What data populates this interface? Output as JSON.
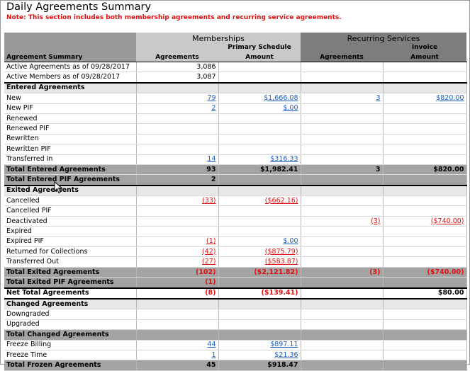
{
  "page": {
    "title": "Daily Agreements Summary",
    "note": "Note: This section includes both membership agreements and recurring service agreements."
  },
  "header": {
    "memberships": "Memberships",
    "recurring": "Recurring Services",
    "primary_schedule": "Primary Schedule",
    "invoice": "Invoice",
    "agreement_summary": "Agreement Summary",
    "agreements": "Agreements",
    "amount": "Amount",
    "agreements2": "Agreements",
    "amount2": "Amount"
  },
  "rows": [
    {
      "type": "data",
      "label": "Active Agreements as of 09/28/2017",
      "m_agr": "3,086",
      "m_amt": "",
      "r_agr": "",
      "r_amt": ""
    },
    {
      "type": "data",
      "label": "Active Members as of 09/28/2017",
      "m_agr": "3,087",
      "m_amt": "",
      "r_agr": "",
      "r_amt": ""
    },
    {
      "type": "section",
      "label": "Entered Agreements"
    },
    {
      "type": "data",
      "label": "New",
      "m_agr": "79",
      "m_amt": "$1,666.08",
      "r_agr": "3",
      "r_amt": "$820.00",
      "style": "link"
    },
    {
      "type": "data",
      "label": "New PIF",
      "m_agr": "2",
      "m_amt": "$.00",
      "r_agr": "",
      "r_amt": "",
      "style": "link"
    },
    {
      "type": "data",
      "label": "Renewed",
      "m_agr": "",
      "m_amt": "",
      "r_agr": "",
      "r_amt": ""
    },
    {
      "type": "data",
      "label": "Renewed PIF",
      "m_agr": "",
      "m_amt": "",
      "r_agr": "",
      "r_amt": ""
    },
    {
      "type": "data",
      "label": "Rewritten",
      "m_agr": "",
      "m_amt": "",
      "r_agr": "",
      "r_amt": ""
    },
    {
      "type": "data",
      "label": "Rewritten PIF",
      "m_agr": "",
      "m_amt": "",
      "r_agr": "",
      "r_amt": ""
    },
    {
      "type": "data",
      "label": "Transferred In",
      "m_agr": "14",
      "m_amt": "$316.33",
      "r_agr": "",
      "r_amt": "",
      "style": "link"
    },
    {
      "type": "total",
      "label": "Total Entered Agreements",
      "m_agr": "93",
      "m_amt": "$1,982.41",
      "r_agr": "3",
      "r_amt": "$820.00"
    },
    {
      "type": "total",
      "label": "Total Entered PIF Agreements",
      "m_agr": "2",
      "m_amt": "",
      "r_agr": "",
      "r_amt": ""
    },
    {
      "type": "section",
      "label": "Exited Agreements"
    },
    {
      "type": "data",
      "label": "Cancelled",
      "m_agr": "(33)",
      "m_amt": "($662.16)",
      "r_agr": "",
      "r_amt": "",
      "style": "neglink"
    },
    {
      "type": "data",
      "label": "Cancelled PIF",
      "m_agr": "",
      "m_amt": "",
      "r_agr": "",
      "r_amt": ""
    },
    {
      "type": "data",
      "label": "Deactivated",
      "m_agr": "",
      "m_amt": "",
      "r_agr": "(3)",
      "r_amt": "($740.00)",
      "style": "neglink"
    },
    {
      "type": "data",
      "label": "Expired",
      "m_agr": "",
      "m_amt": "",
      "r_agr": "",
      "r_amt": ""
    },
    {
      "type": "data",
      "label": "Expired PIF",
      "m_agr": "(1)",
      "m_amt": "$.00",
      "r_agr": "",
      "r_amt": "",
      "style": "mixed"
    },
    {
      "type": "data",
      "label": "Returned for Collections",
      "m_agr": "(42)",
      "m_amt": "($875.79)",
      "r_agr": "",
      "r_amt": "",
      "style": "neglink"
    },
    {
      "type": "data",
      "label": "Transferred Out",
      "m_agr": "(27)",
      "m_amt": "($583.87)",
      "r_agr": "",
      "r_amt": "",
      "style": "neglink"
    },
    {
      "type": "total",
      "label": "Total Exited Agreements",
      "m_agr": "(102)",
      "m_amt": "($2,121.82)",
      "r_agr": "(3)",
      "r_amt": "($740.00)",
      "style": "neg"
    },
    {
      "type": "total",
      "label": "Total Exited PIF Agreements",
      "m_agr": "(1)",
      "m_amt": "",
      "r_agr": "",
      "r_amt": "",
      "style": "neg"
    },
    {
      "type": "net",
      "label": "Net Total Agreements",
      "m_agr": "(8)",
      "m_amt": "($139.41)",
      "r_agr": "",
      "r_amt": "$80.00",
      "style": "netmix"
    },
    {
      "type": "section",
      "label": "Changed Agreements"
    },
    {
      "type": "data",
      "label": "Downgraded",
      "m_agr": "",
      "m_amt": "",
      "r_agr": "",
      "r_amt": ""
    },
    {
      "type": "data",
      "label": "Upgraded",
      "m_agr": "",
      "m_amt": "",
      "r_agr": "",
      "r_amt": ""
    },
    {
      "type": "total",
      "label": "Total Changed Agreements",
      "m_agr": "",
      "m_amt": "",
      "r_agr": "",
      "r_amt": ""
    },
    {
      "type": "data",
      "label": "Freeze Billing",
      "m_agr": "44",
      "m_amt": "$897.11",
      "r_agr": "",
      "r_amt": "",
      "style": "link"
    },
    {
      "type": "data",
      "label": "Freeze Time",
      "m_agr": "1",
      "m_amt": "$21.36",
      "r_agr": "",
      "r_amt": "",
      "style": "link"
    },
    {
      "type": "total",
      "label": "Total Frozen Agreements",
      "m_agr": "45",
      "m_amt": "$918.47",
      "r_agr": "",
      "r_amt": ""
    }
  ]
}
